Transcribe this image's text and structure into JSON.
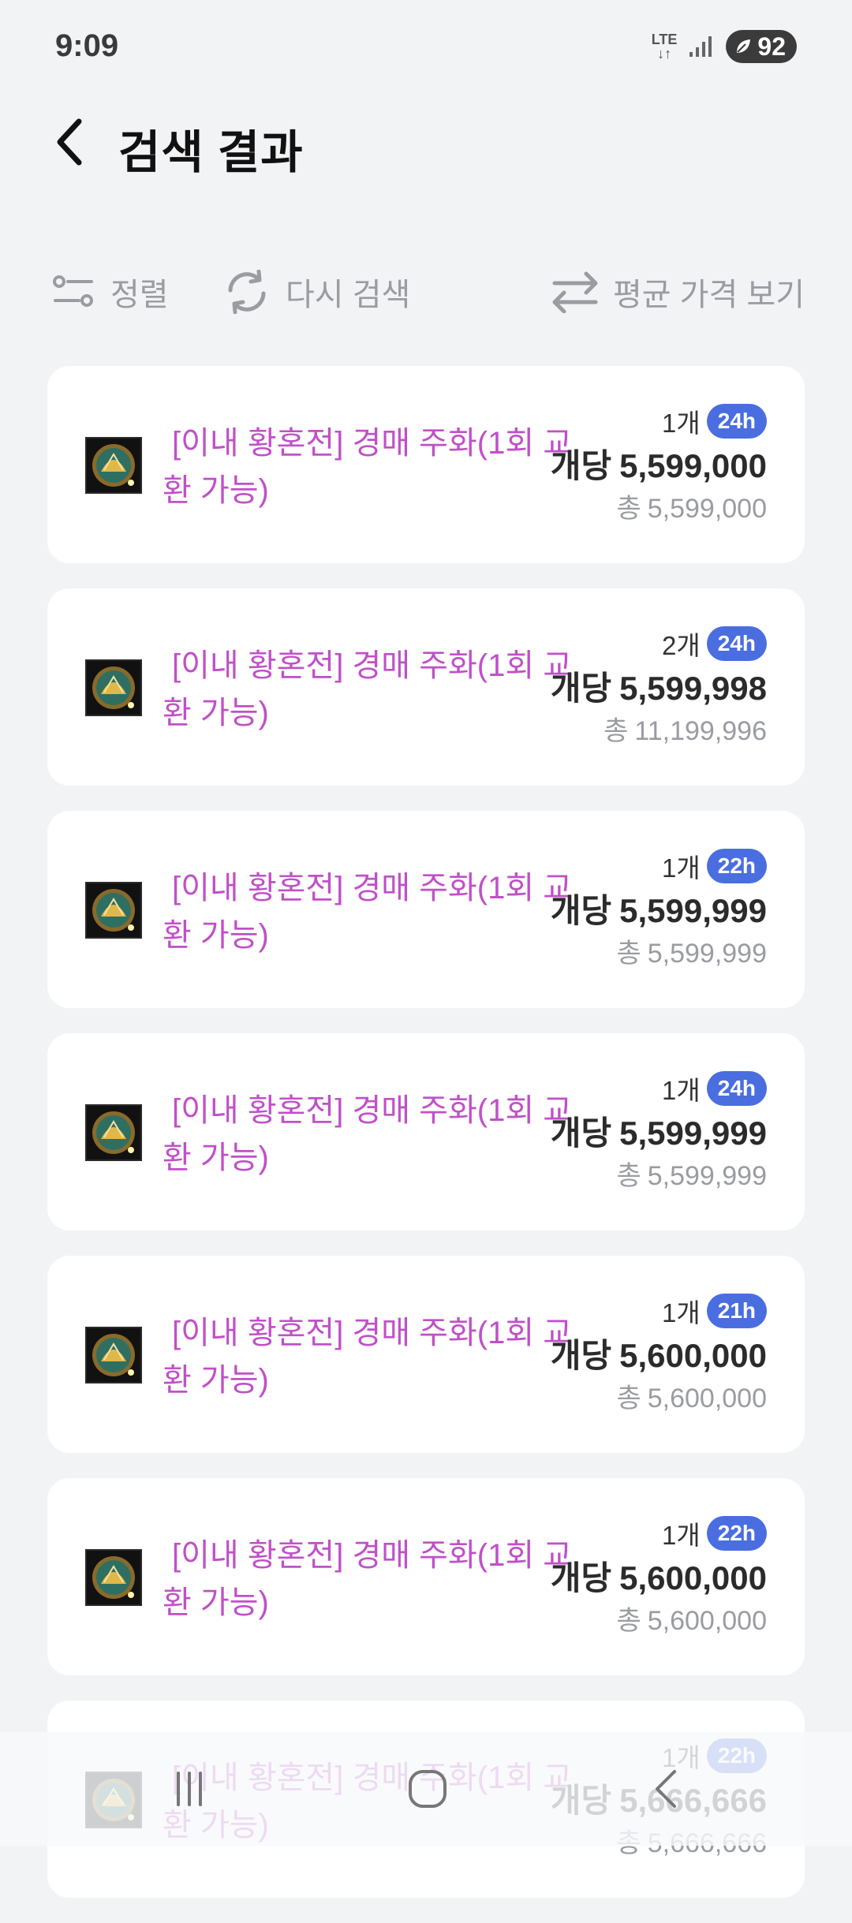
{
  "status": {
    "time": "9:09",
    "network": "LTE",
    "battery": "92"
  },
  "header": {
    "title": "검색 결과"
  },
  "toolbar": {
    "sort_label": "정렬",
    "research_label": "다시 검색",
    "avg_label": "평균 가격 보기"
  },
  "labels": {
    "unit": "개당",
    "total": "총"
  },
  "colors": {
    "item_name": "#c050c8",
    "badge": "#4a6ee0",
    "muted": "#9a9ca2"
  },
  "listings": [
    {
      "name": "[이내 황혼전] 경매 주화(1회 교환 가능)",
      "qty": "1개",
      "time": "24h",
      "unit_price": "5,599,000",
      "total": "5,599,000"
    },
    {
      "name": "[이내 황혼전] 경매 주화(1회 교환 가능)",
      "qty": "2개",
      "time": "24h",
      "unit_price": "5,599,998",
      "total": "11,199,996"
    },
    {
      "name": "[이내 황혼전] 경매 주화(1회 교환 가능)",
      "qty": "1개",
      "time": "22h",
      "unit_price": "5,599,999",
      "total": "5,599,999"
    },
    {
      "name": "[이내 황혼전] 경매 주화(1회 교환 가능)",
      "qty": "1개",
      "time": "24h",
      "unit_price": "5,599,999",
      "total": "5,599,999"
    },
    {
      "name": "[이내 황혼전] 경매 주화(1회 교환 가능)",
      "qty": "1개",
      "time": "21h",
      "unit_price": "5,600,000",
      "total": "5,600,000"
    },
    {
      "name": "[이내 황혼전] 경매 주화(1회 교환 가능)",
      "qty": "1개",
      "time": "22h",
      "unit_price": "5,600,000",
      "total": "5,600,000"
    },
    {
      "name": "[이내 황혼전] 경매 주화(1회 교환 가능)",
      "qty": "1개",
      "time": "22h",
      "unit_price": "5,666,666",
      "total": "5,666,666"
    }
  ]
}
